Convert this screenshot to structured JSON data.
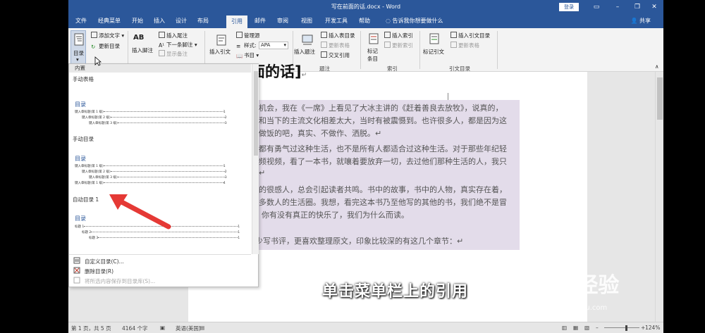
{
  "window": {
    "title": "写在前面的话.docx - Word",
    "login_label": "登录",
    "accent": "#2b579a"
  },
  "tabs": [
    "文件",
    "经典菜单",
    "开始",
    "插入",
    "设计",
    "布局",
    "引用",
    "邮件",
    "审阅",
    "视图",
    "开发工具",
    "帮助"
  ],
  "active_tab": "引用",
  "tell_me": "告诉我你想要做什么",
  "share_label": "共享",
  "ribbon": {
    "toc": {
      "label": "目录",
      "add_text": "添加文字",
      "update_toc": "更新目录"
    },
    "footnotes": {
      "insert_footnote": "插入脚注",
      "insert_endnote": "插入尾注",
      "next_footnote": "下一条脚注",
      "show_notes": "显示备注",
      "ab_icon_text": "AB",
      "group_label": "脚注"
    },
    "citations": {
      "insert_citation": "插入引文",
      "manage_sources": "管理源",
      "style_label": "样式:",
      "style_value": "APA",
      "bibliography": "书目"
    },
    "captions": {
      "insert_caption": "插入题注",
      "insert_table_of_figures": "插入表目录",
      "update_table": "更新表格",
      "cross_reference": "交叉引用",
      "group_label": "题注"
    },
    "index": {
      "mark_entry": "标记\n条目",
      "insert_index": "插入索引",
      "update_index": "更新索引",
      "group_label": "索引"
    },
    "authorities": {
      "mark_citation": "标记引文",
      "insert_table_of_authorities": "插入引文目录",
      "update_table": "更新表格",
      "group_label": "引文目录"
    }
  },
  "gallery": {
    "header": "内置",
    "sections": [
      {
        "name": "手动表格",
        "toc_title": "目录",
        "lines": [
          {
            "text": "键入章标题(第 1 级)",
            "page": "1",
            "level": 1
          },
          {
            "text": "键入章标题(第 2 级)",
            "page": "2",
            "level": 2
          },
          {
            "text": "键入章标题(第 3 级)",
            "page": "3",
            "level": 3
          }
        ]
      },
      {
        "name": "手动目录",
        "toc_title": "目录",
        "lines": [
          {
            "text": "键入章标题(第 1 级)",
            "page": "1",
            "level": 1
          },
          {
            "text": "键入章标题(第 2 级)",
            "page": "2",
            "level": 2
          },
          {
            "text": "键入章标题(第 3 级)",
            "page": "3",
            "level": 3
          },
          {
            "text": "键入章标题(第 1 级)",
            "page": "4",
            "level": 1
          }
        ]
      },
      {
        "name": "自动目录 1",
        "toc_title": "目录",
        "lines": [
          {
            "text": "标题 1",
            "page": "1",
            "level": 1
          },
          {
            "text": "标题 2",
            "page": "1",
            "level": 2
          },
          {
            "text": "标题 3",
            "page": "1",
            "level": 3
          }
        ]
      }
    ],
    "menu": [
      {
        "label": "自定义目录(C)...",
        "enabled": true
      },
      {
        "label": "删除目录(R)",
        "enabled": true
      },
      {
        "label": "将所选内容保存到目录库(S)...",
        "enabled": false
      }
    ]
  },
  "document": {
    "heading": "面的话]",
    "heading_mark": "↵",
    "lines": [
      "机会，我在《一席》上看见了大冰主讲的《赶着善良去放牧》，说真的，",
      "和当下的主流文化相差太大，当时有被震慑到。也许很多人，都是因为这",
      "做饭的吧，真实、不做作、洒脱。↵",
      "都有勇气过这种生活，也不是所有人都适合过这种生活。对于那些年纪轻",
      "频视频，看了一本书，就嚷着要放弃一切，去过他们那种生活的人，我只",
      "↵",
      "的很感人，总会引起读者共鸣。书中的故事，书中的人物，真实存在着，",
      "多数人的生活圈。我想，看完这本书乃至他写的其他的书，我们绝不是冒",
      "才是真正的快乐，你有没有真正的快乐了，我们为什么而读。",
      "现在已经很少写书评，更喜欢整理原文，印象比较深的有这几个章节：↵"
    ]
  },
  "status": {
    "page": "第 1 页，共 5 页",
    "words": "4164 个字",
    "language": "英语(美国)",
    "zoom": "124%"
  },
  "overlay": {
    "subtitle": "单击菜单栏上的引用",
    "watermark": "Bai经验",
    "watermark_url": "jingyan.baidu.com"
  }
}
